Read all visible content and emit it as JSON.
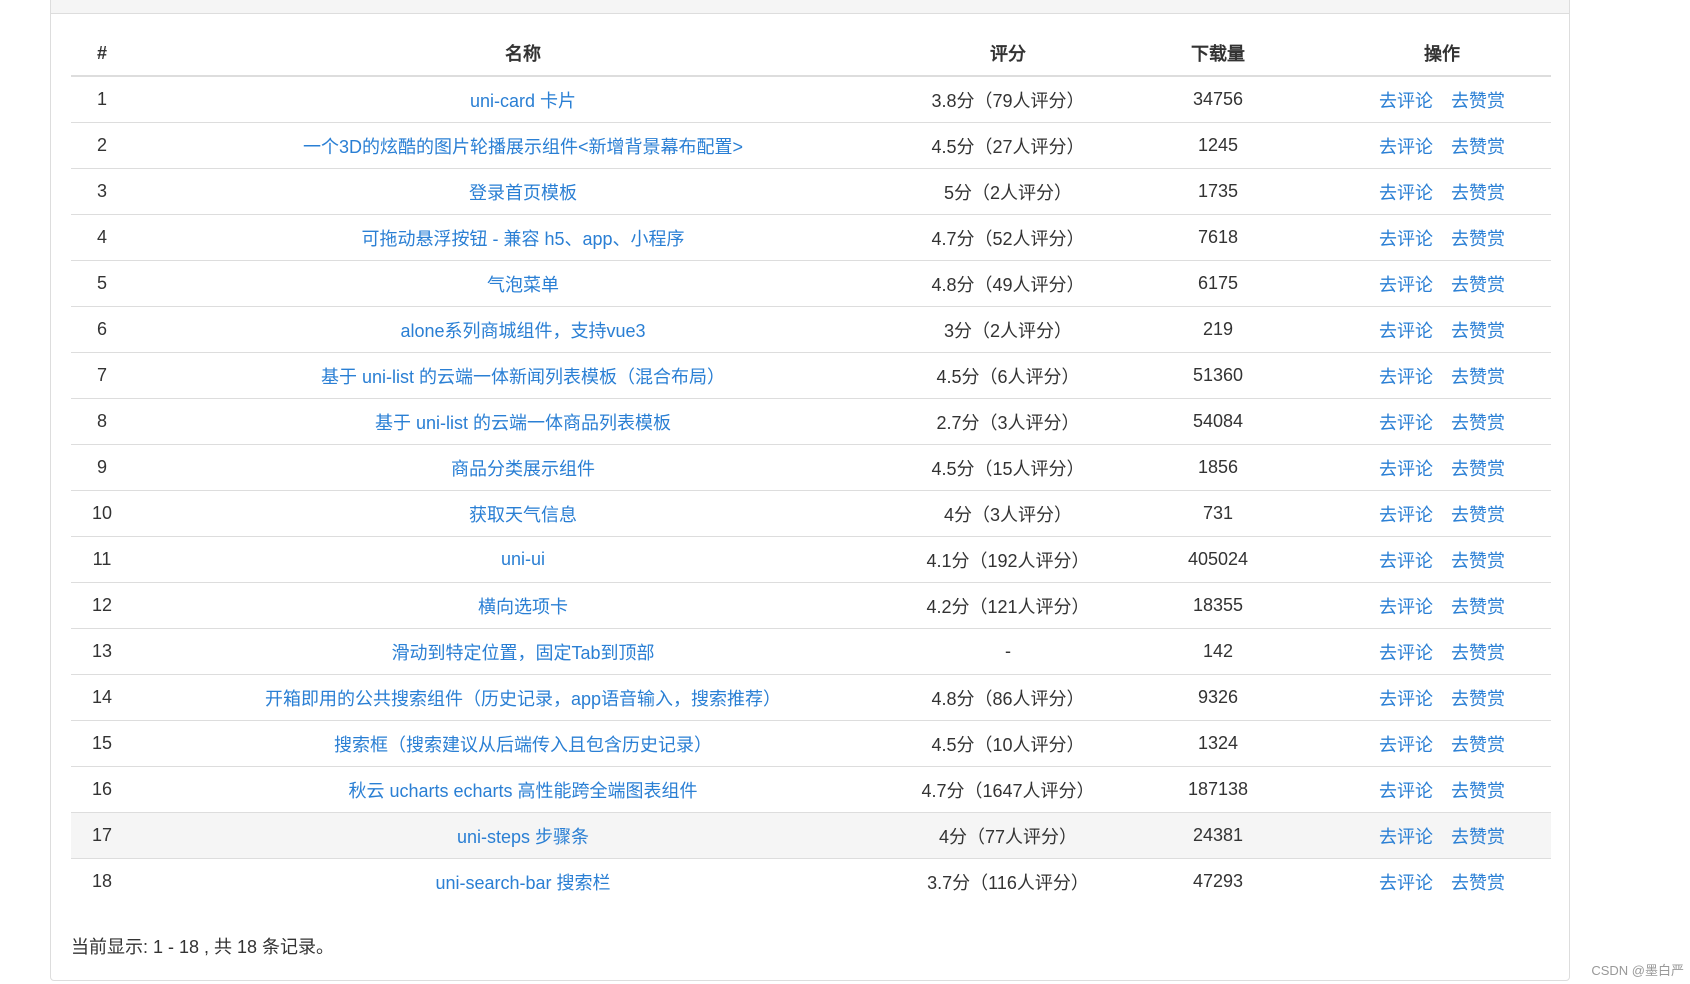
{
  "table": {
    "headers": {
      "index": "#",
      "name": "名称",
      "score": "评分",
      "downloads": "下载量",
      "actions": "操作"
    },
    "action_labels": {
      "comment": "去评论",
      "reward": "去赞赏"
    },
    "rows": [
      {
        "index": "1",
        "name": "uni-card 卡片",
        "score": "3.8分（79人评分）",
        "downloads": "34756"
      },
      {
        "index": "2",
        "name": "一个3D的炫酷的图片轮播展示组件<新增背景幕布配置>",
        "score": "4.5分（27人评分）",
        "downloads": "1245"
      },
      {
        "index": "3",
        "name": "登录首页模板",
        "score": "5分（2人评分）",
        "downloads": "1735"
      },
      {
        "index": "4",
        "name": "可拖动悬浮按钮 - 兼容 h5、app、小程序",
        "score": "4.7分（52人评分）",
        "downloads": "7618"
      },
      {
        "index": "5",
        "name": "气泡菜单",
        "score": "4.8分（49人评分）",
        "downloads": "6175"
      },
      {
        "index": "6",
        "name": "alone系列商城组件，支持vue3",
        "score": "3分（2人评分）",
        "downloads": "219"
      },
      {
        "index": "7",
        "name": "基于 uni-list 的云端一体新闻列表模板（混合布局）",
        "score": "4.5分（6人评分）",
        "downloads": "51360"
      },
      {
        "index": "8",
        "name": "基于 uni-list 的云端一体商品列表模板",
        "score": "2.7分（3人评分）",
        "downloads": "54084"
      },
      {
        "index": "9",
        "name": "商品分类展示组件",
        "score": "4.5分（15人评分）",
        "downloads": "1856"
      },
      {
        "index": "10",
        "name": "获取天气信息",
        "score": "4分（3人评分）",
        "downloads": "731"
      },
      {
        "index": "11",
        "name": "uni-ui",
        "score": "4.1分（192人评分）",
        "downloads": "405024"
      },
      {
        "index": "12",
        "name": "横向选项卡",
        "score": "4.2分（121人评分）",
        "downloads": "18355"
      },
      {
        "index": "13",
        "name": "滑动到特定位置，固定Tab到顶部",
        "score": "-",
        "downloads": "142"
      },
      {
        "index": "14",
        "name": "开箱即用的公共搜索组件（历史记录，app语音输入，搜索推荐）",
        "score": "4.8分（86人评分）",
        "downloads": "9326"
      },
      {
        "index": "15",
        "name": "搜索框（搜索建议从后端传入且包含历史记录）",
        "score": "4.5分（10人评分）",
        "downloads": "1324"
      },
      {
        "index": "16",
        "name": "秋云 ucharts echarts 高性能跨全端图表组件",
        "score": "4.7分（1647人评分）",
        "downloads": "187138"
      },
      {
        "index": "17",
        "name": "uni-steps 步骤条",
        "score": "4分（77人评分）",
        "downloads": "24381"
      },
      {
        "index": "18",
        "name": "uni-search-bar 搜索栏",
        "score": "3.7分（116人评分）",
        "downloads": "47293"
      }
    ]
  },
  "summary": "当前显示: 1 - 18 , 共 18 条记录。",
  "watermark": "CSDN @墨白严",
  "colors": {
    "link": "#2a7fd4",
    "border": "#dddddd",
    "highlight_row": "#f5f5f5"
  }
}
